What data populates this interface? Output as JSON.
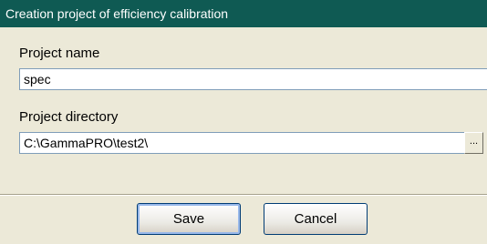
{
  "window": {
    "title": "Creation project of efficiency calibration"
  },
  "form": {
    "project_name_label": "Project name",
    "project_name_value": "spec",
    "project_directory_label": "Project directory",
    "project_directory_value": "C:\\GammaPRO\\test2\\",
    "browse_label": "..."
  },
  "buttons": {
    "save_label": "Save",
    "cancel_label": "Cancel"
  },
  "colors": {
    "titlebar": "#0f5a53",
    "background": "#ece9d8"
  }
}
